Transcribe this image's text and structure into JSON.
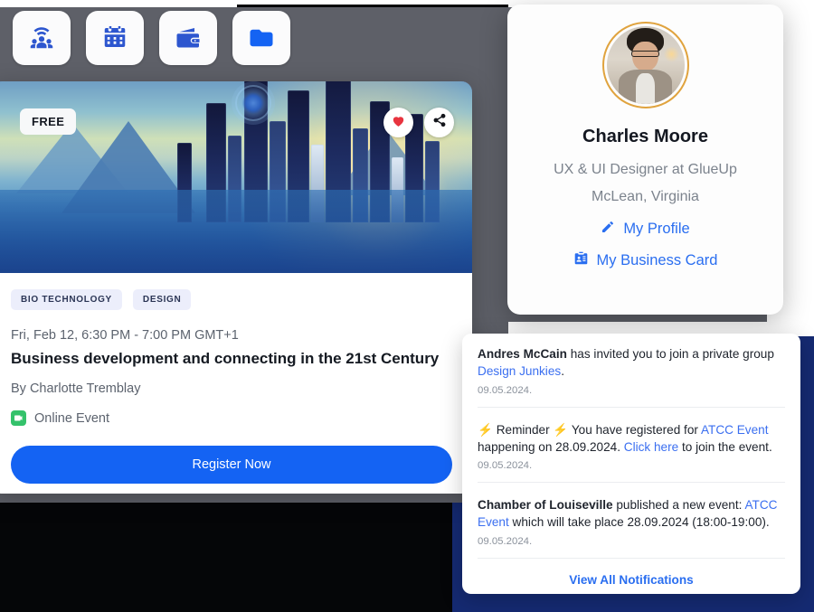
{
  "toolbar": {
    "items": [
      {
        "icon": "community-network-icon",
        "label": "Community"
      },
      {
        "icon": "calendar-icon",
        "label": "Events"
      },
      {
        "icon": "wallet-icon",
        "label": "Finance"
      },
      {
        "icon": "folder-icon",
        "label": "Documents"
      }
    ]
  },
  "event_card": {
    "price_badge": "FREE",
    "favorite_icon": "heart-icon",
    "share_icon": "share-icon",
    "hero_alt": "futuristic blue city skyline illustration",
    "tags": [
      "BIO TECHNOLOGY",
      "DESIGN"
    ],
    "date": "Fri, Feb 12, 6:30 PM - 7:00 PM GMT+1",
    "title": "Business development and connecting in the 21st Century",
    "host": "By Charlotte Tremblay",
    "mode": "Online Event",
    "mode_icon": "video-chat-icon",
    "register_label": "Register Now"
  },
  "profile_card": {
    "avatar_alt": "portrait of Charles Moore",
    "name": "Charles Moore",
    "role": "UX & UI Designer at GlueUp",
    "location": "McLean, Virginia",
    "links": [
      {
        "icon": "pencil-icon",
        "label": "My Profile"
      },
      {
        "icon": "id-card-icon",
        "label": "My Business Card"
      }
    ]
  },
  "notifications": {
    "items": [
      {
        "parts": [
          {
            "t": "Andres McCain",
            "s": "bold"
          },
          {
            "t": " has invited you to join a private group ",
            "s": "plain"
          },
          {
            "t": "Design Junkies",
            "s": "link"
          },
          {
            "t": ".",
            "s": "plain"
          }
        ],
        "date": "09.05.2024."
      },
      {
        "parts": [
          {
            "t": "⚡ Reminder ⚡ You have registered for ",
            "s": "plain"
          },
          {
            "t": "ATCC Event",
            "s": "link"
          },
          {
            "t": " happening on 28.09.2024. ",
            "s": "plain"
          },
          {
            "t": "Click here",
            "s": "link"
          },
          {
            "t": " to join the event.",
            "s": "plain"
          }
        ],
        "date": "09.05.2024."
      },
      {
        "parts": [
          {
            "t": "Chamber of Louiseville",
            "s": "bold"
          },
          {
            "t": " published a new event: ",
            "s": "plain"
          },
          {
            "t": "ATCC Event",
            "s": "link"
          },
          {
            "t": " which will take place 28.09.2024 (18:00-19:00).",
            "s": "plain"
          }
        ],
        "date": "09.05.2024."
      }
    ],
    "footer_label": "View All Notifications"
  },
  "colors": {
    "primary_blue": "#1463f3",
    "link_blue": "#2a6ef0",
    "navy_backdrop": "#152a72",
    "gray_backdrop": "#5e6068",
    "avatar_ring": "#e0a33e",
    "online_green": "#34c26b",
    "heart_red": "#e8343f",
    "tag_bg": "#eceefb"
  }
}
